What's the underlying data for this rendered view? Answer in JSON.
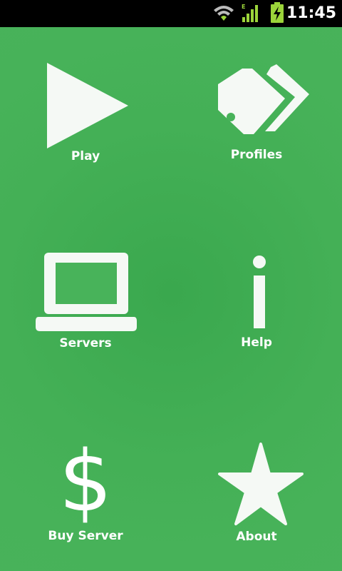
{
  "status_bar": {
    "time": "11:45",
    "icons": [
      "wifi-icon",
      "signal-icon",
      "battery-charging-icon"
    ]
  },
  "colors": {
    "background": "#48b35a",
    "icon": "#f5f9f5",
    "status_bar": "#000000",
    "status_accent": "#9bd43a"
  },
  "menu": {
    "play": {
      "label": "Play",
      "icon": "play-icon"
    },
    "profiles": {
      "label": "Profiles",
      "icon": "tags-icon"
    },
    "servers": {
      "label": "Servers",
      "icon": "laptop-icon"
    },
    "help": {
      "label": "Help",
      "icon": "info-icon"
    },
    "buy_server": {
      "label": "Buy Server",
      "icon": "dollar-icon",
      "glyph": "$"
    },
    "about": {
      "label": "About",
      "icon": "star-icon"
    }
  }
}
